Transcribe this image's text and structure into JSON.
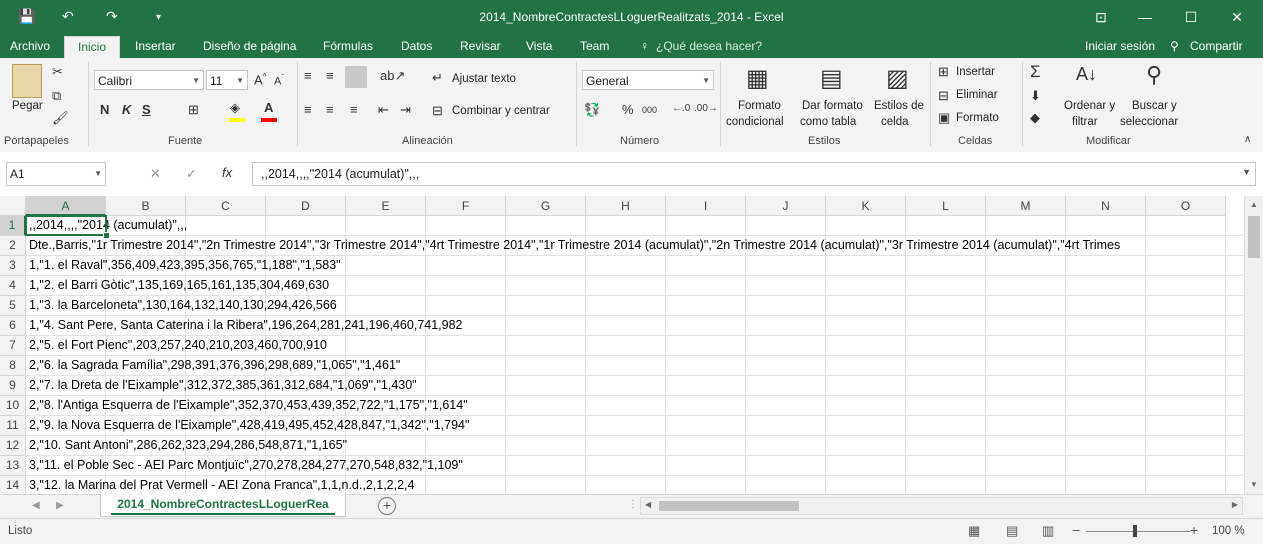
{
  "window": {
    "title": "2014_NombreContractesLLoguerRealitzats_2014 - Excel",
    "save_icon": "💾",
    "undo_icon": "↶",
    "redo_icon": "↷",
    "ribbon_display_icon": "⊡",
    "minimize": "—",
    "maximize": "☐",
    "close": "✕"
  },
  "menu": {
    "tabs": [
      "Archivo",
      "Inicio",
      "Insertar",
      "Diseño de página",
      "Fórmulas",
      "Datos",
      "Revisar",
      "Vista",
      "Team"
    ],
    "tell_me": "¿Qué desea hacer?",
    "sign_in": "Iniciar sesión",
    "share": "Compartir"
  },
  "ribbon": {
    "clipboard": {
      "paste": "Pegar",
      "label": "Portapapeles"
    },
    "font": {
      "name": "Calibri",
      "size": "11",
      "label": "Fuente",
      "bold": "N",
      "italic": "K",
      "underline": "S"
    },
    "alignment": {
      "wrap": "Ajustar texto",
      "merge": "Combinar y centrar",
      "label": "Alineación"
    },
    "number": {
      "format": "General",
      "label": "Número",
      "percent": "%",
      "thousands": "000"
    },
    "styles": {
      "conditional_1": "Formato",
      "conditional_2": "condicional",
      "table_1": "Dar formato",
      "table_2": "como tabla",
      "cell_1": "Estilos de",
      "cell_2": "celda",
      "label": "Estilos"
    },
    "cells": {
      "insert": "Insertar",
      "delete": "Eliminar",
      "format": "Formato",
      "label": "Celdas"
    },
    "editing": {
      "sort_1": "Ordenar y",
      "sort_2": "filtrar",
      "find_1": "Buscar y",
      "find_2": "seleccionar",
      "label": "Modificar"
    }
  },
  "formula_bar": {
    "name_box": "A1",
    "fx": "fx",
    "content": ",,2014,,,,\"2014 (acumulat)\",,,"
  },
  "grid": {
    "columns": [
      "A",
      "B",
      "C",
      "D",
      "E",
      "F",
      "G",
      "H",
      "I",
      "J",
      "K",
      "L",
      "M",
      "N",
      "O"
    ],
    "rows": [
      {
        "n": "1",
        "text": ",,2014,,,,\"2014 (acumulat)\",,,"
      },
      {
        "n": "2",
        "text": "Dte.,Barris,\"1r Trimestre 2014\",\"2n Trimestre 2014\",\"3r Trimestre 2014\",\"4rt Trimestre 2014\",\"1r Trimestre 2014 (acumulat)\",\"2n Trimestre 2014 (acumulat)\",\"3r Trimestre 2014 (acumulat)\",\"4rt Trimes"
      },
      {
        "n": "3",
        "text": "1,\"1. el Raval\",356,409,423,395,356,765,\"1,188\",\"1,583\""
      },
      {
        "n": "4",
        "text": "1,\"2. el Barri Gòtic\",135,169,165,161,135,304,469,630"
      },
      {
        "n": "5",
        "text": "1,\"3. la Barceloneta\",130,164,132,140,130,294,426,566"
      },
      {
        "n": "6",
        "text": "1,\"4. Sant Pere, Santa Caterina i la Ribera\",196,264,281,241,196,460,741,982"
      },
      {
        "n": "7",
        "text": "2,\"5. el Fort Pienc\",203,257,240,210,203,460,700,910"
      },
      {
        "n": "8",
        "text": "2,\"6. la Sagrada Família\",298,391,376,396,298,689,\"1,065\",\"1,461\""
      },
      {
        "n": "9",
        "text": "2,\"7. la Dreta de l'Eixample\",312,372,385,361,312,684,\"1,069\",\"1,430\""
      },
      {
        "n": "10",
        "text": "2,\"8. l'Antiga Esquerra de l'Eixample\",352,370,453,439,352,722,\"1,175\",\"1,614\""
      },
      {
        "n": "11",
        "text": "2,\"9. la Nova Esquerra de l'Eixample\",428,419,495,452,428,847,\"1,342\",\"1,794\""
      },
      {
        "n": "12",
        "text": "2,\"10. Sant Antoni\",286,262,323,294,286,548,871,\"1,165\""
      },
      {
        "n": "13",
        "text": "3,\"11. el Poble Sec - AEI Parc Montjuïc\",270,278,284,277,270,548,832,\"1,109\""
      },
      {
        "n": "14",
        "text": "3,\"12. la Marina del Prat Vermell - AEI Zona Franca\",1,1,n.d.,2,1,2,2,4"
      }
    ]
  },
  "sheets": {
    "active": "2014_NombreContractesLLoguerRea",
    "add": "+"
  },
  "status": {
    "ready": "Listo",
    "zoom": "100 %"
  }
}
